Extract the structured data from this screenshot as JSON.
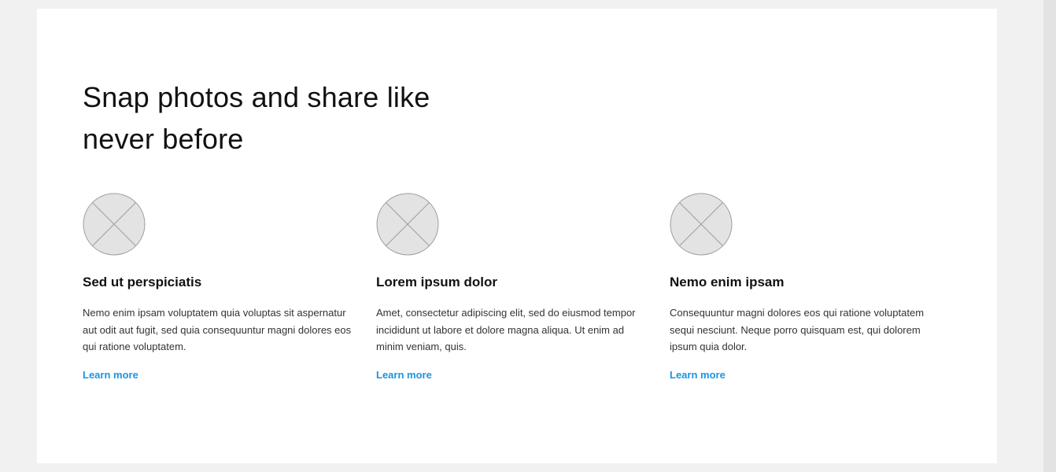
{
  "section": {
    "headline": "Snap photos and share like never before"
  },
  "features": [
    {
      "title": "Sed ut perspiciatis",
      "description": "Nemo enim ipsam voluptatem quia voluptas sit aspernatur aut odit aut fugit, sed quia consequuntur magni dolores eos qui ratione voluptatem.",
      "link_label": "Learn more",
      "icon": "image-placeholder-icon"
    },
    {
      "title": "Lorem ipsum dolor",
      "description": "Amet, consectetur adipiscing elit, sed do eiusmod tempor incididunt ut labore et dolore magna aliqua. Ut enim ad minim veniam, quis.",
      "link_label": "Learn more",
      "icon": "image-placeholder-icon"
    },
    {
      "title": "Nemo enim ipsam",
      "description": "Consequuntur magni dolores eos qui ratione voluptatem sequi nesciunt. Neque porro quisquam est, qui dolorem ipsum quia dolor.",
      "link_label": "Learn more",
      "icon": "image-placeholder-icon"
    }
  ],
  "colors": {
    "page_background": "#f1f1f1",
    "card_background": "#ffffff",
    "link": "#1996e0",
    "placeholder_fill": "#e3e3e3",
    "placeholder_stroke": "#9e9e9e"
  }
}
